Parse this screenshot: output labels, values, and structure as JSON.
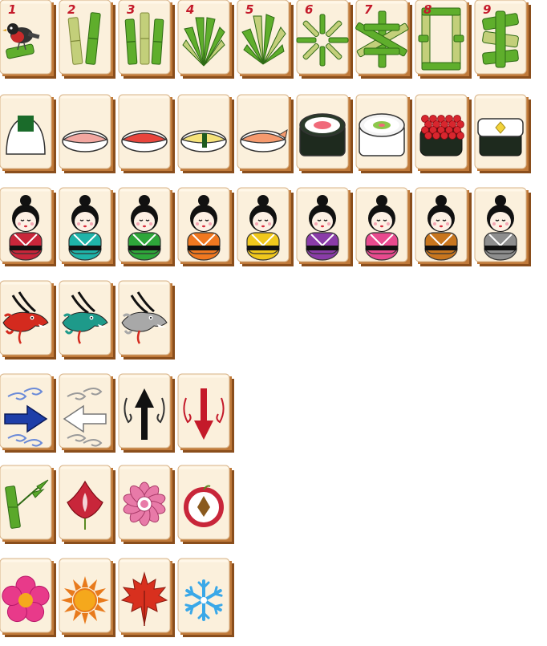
{
  "game": "mahjong-tile-set",
  "colors": {
    "tile_face": "#fbf0dc",
    "tile_edge": "#c07a3a",
    "tile_shadow": "#8a4e1c",
    "number_red": "#c41a2a",
    "bamboo_green": "#4c9a22",
    "bamboo_light": "#b6c872"
  },
  "rows": [
    {
      "suit": "bamboo",
      "tiles": [
        {
          "icon": "bird-on-bamboo-icon",
          "label": "1"
        },
        {
          "icon": "bamboo-2-icon",
          "label": "2"
        },
        {
          "icon": "bamboo-3-icon",
          "label": "3"
        },
        {
          "icon": "bamboo-4-icon",
          "label": "4"
        },
        {
          "icon": "bamboo-5-icon",
          "label": "5"
        },
        {
          "icon": "bamboo-6-icon",
          "label": "6"
        },
        {
          "icon": "bamboo-7-icon",
          "label": "7"
        },
        {
          "icon": "bamboo-8-icon",
          "label": "8"
        },
        {
          "icon": "bamboo-9-icon",
          "label": "9"
        }
      ]
    },
    {
      "suit": "sushi",
      "tiles": [
        {
          "icon": "onigiri-icon",
          "color": "#1a6b2a"
        },
        {
          "icon": "tuna-nigiri-icon",
          "color": "#f2a7a0"
        },
        {
          "icon": "salmon-nigiri-icon",
          "color": "#e8453c"
        },
        {
          "icon": "tamago-nigiri-icon",
          "color": "#f5e27a"
        },
        {
          "icon": "shrimp-nigiri-icon",
          "color": "#f59a6e"
        },
        {
          "icon": "maki-roll-icon",
          "color": "#f06a7a"
        },
        {
          "icon": "uramaki-roll-icon",
          "color": "#8cc84b"
        },
        {
          "icon": "ikura-gunkan-icon",
          "color": "#d8262e"
        },
        {
          "icon": "tamago-roll-icon",
          "color": "#f2d23a"
        }
      ]
    },
    {
      "suit": "kokeshi",
      "tiles": [
        {
          "icon": "kokeshi-doll-icon",
          "color": "#c8263a"
        },
        {
          "icon": "kokeshi-doll-icon",
          "color": "#1fb3a8"
        },
        {
          "icon": "kokeshi-doll-icon",
          "color": "#2ea63a"
        },
        {
          "icon": "kokeshi-doll-icon",
          "color": "#f07820"
        },
        {
          "icon": "kokeshi-doll-icon",
          "color": "#f0c81c"
        },
        {
          "icon": "kokeshi-doll-icon",
          "color": "#8a3ca8"
        },
        {
          "icon": "kokeshi-doll-icon",
          "color": "#e84a8e"
        },
        {
          "icon": "kokeshi-doll-icon",
          "color": "#c8761e"
        },
        {
          "icon": "kokeshi-doll-icon",
          "color": "#8e8e8e"
        }
      ]
    },
    {
      "suit": "dragons",
      "tiles": [
        {
          "icon": "red-dragon-icon",
          "color": "#d42a1e"
        },
        {
          "icon": "green-dragon-icon",
          "color": "#1e9a8a"
        },
        {
          "icon": "white-dragon-icon",
          "color": "#a8a8a8"
        }
      ]
    },
    {
      "suit": "winds",
      "tiles": [
        {
          "icon": "east-wind-arrow-icon",
          "color": "#1e3ea8"
        },
        {
          "icon": "west-wind-arrow-icon",
          "color": "#ffffff"
        },
        {
          "icon": "north-wind-arrow-icon",
          "color": "#111111"
        },
        {
          "icon": "south-wind-arrow-icon",
          "color": "#c41a2a"
        }
      ]
    },
    {
      "suit": "flowers",
      "tiles": [
        {
          "icon": "bamboo-sprig-icon",
          "color": "#5aa82a"
        },
        {
          "icon": "orchid-icon",
          "color": "#c8263a"
        },
        {
          "icon": "chrysanthemum-icon",
          "color": "#e87aa8"
        },
        {
          "icon": "plum-icon",
          "color": "#c8263a"
        }
      ]
    },
    {
      "suit": "seasons",
      "tiles": [
        {
          "icon": "spring-flower-icon",
          "color": "#e83a8a"
        },
        {
          "icon": "summer-sun-icon",
          "color": "#f5a81c"
        },
        {
          "icon": "autumn-maple-leaf-icon",
          "color": "#d8301e"
        },
        {
          "icon": "winter-snowflake-icon",
          "color": "#3aa8e8"
        }
      ]
    }
  ]
}
